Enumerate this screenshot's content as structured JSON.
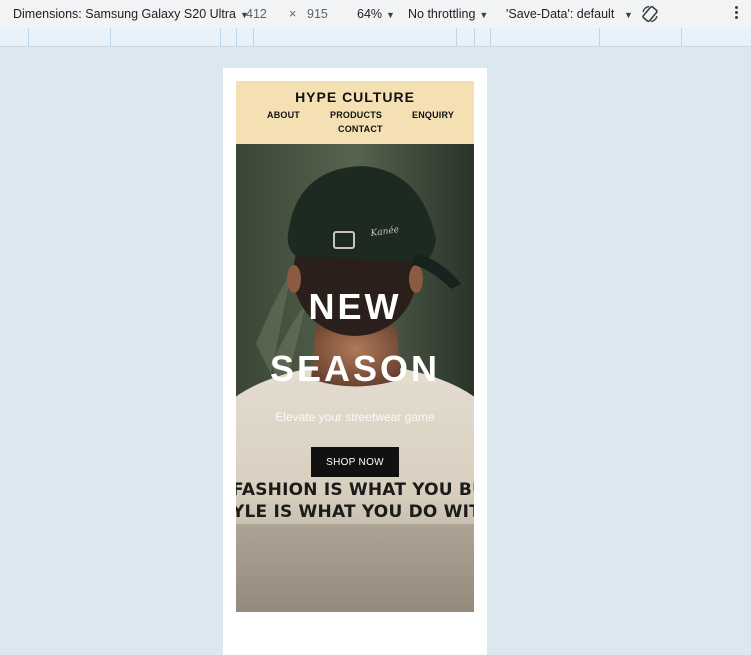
{
  "devtools": {
    "dimensions_label": "Dimensions: Samsung Galaxy S20 Ultra",
    "width": "412",
    "times": "×",
    "height": "915",
    "zoom": "64%",
    "throttling": "No throttling",
    "save_data": "'Save-Data': default",
    "icons": [
      "rotate-icon",
      "more-vert-icon",
      "caret-down-icon"
    ]
  },
  "site": {
    "brand": "HYPE CULTURE",
    "nav": {
      "about": "ABOUT",
      "products": "PRODUCTS",
      "enquiry": "ENQUIRY",
      "contact": "CONTACT"
    },
    "hero": {
      "title_line1": "NEW",
      "title_line2": "SEASON",
      "subtitle": "Elevate your streetwear game",
      "cta": "SHOP NOW",
      "cap_logo": "Kanée",
      "shirt_line1": "FASHION IS WHAT YOU BUY",
      "shirt_line2": "YLE IS WHAT YOU DO WITH"
    }
  },
  "colors": {
    "header_bg": "#f5e0b4",
    "page_bg": "#dbe8f0",
    "button_bg": "#111111"
  }
}
